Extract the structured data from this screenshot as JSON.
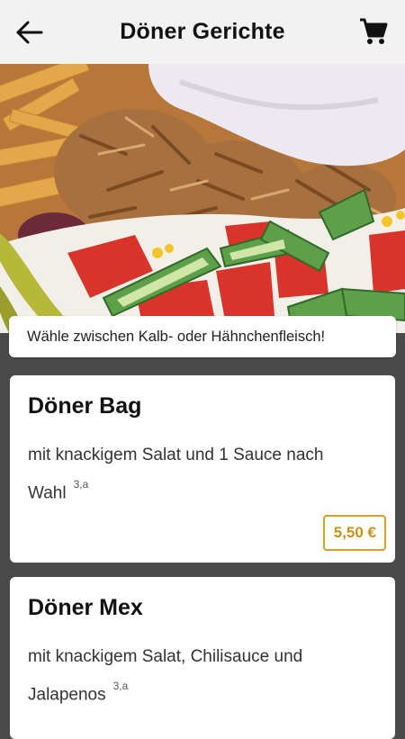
{
  "header": {
    "title": "Döner Gerichte"
  },
  "info_text": "Wähle zwischen Kalb- oder Hähnchenfleisch!",
  "items": [
    {
      "name": "Döner Bag",
      "description": "mit knackigem Salat und 1 Sauce nach Wahl",
      "footnote": "3,a",
      "price": "5,50 €"
    },
    {
      "name": "Döner Mex",
      "description": "mit knackigem Salat, Chilisauce und Jalapenos",
      "footnote": "3,a"
    }
  ],
  "colors": {
    "accent": "#d4a12a",
    "header_bg": "#f2f2f2",
    "page_bg": "#4a4a4a"
  },
  "icons": {
    "back": "arrow-left-icon",
    "cart": "shopping-cart-icon"
  }
}
